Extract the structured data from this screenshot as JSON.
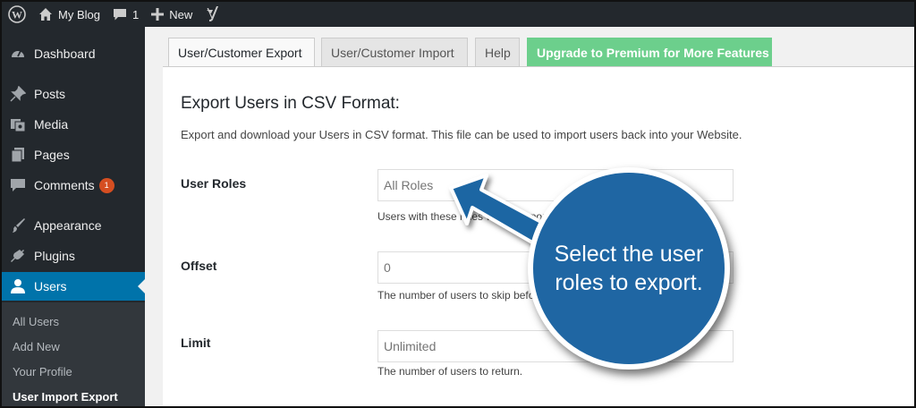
{
  "adminbar": {
    "site_name": "My Blog",
    "comments_count": "1",
    "new_label": "New"
  },
  "sidebar": {
    "items": [
      {
        "label": "Dashboard",
        "icon": "dashboard-icon"
      },
      {
        "label": "Posts",
        "icon": "pin-icon"
      },
      {
        "label": "Media",
        "icon": "media-icon"
      },
      {
        "label": "Pages",
        "icon": "pages-icon"
      },
      {
        "label": "Comments",
        "icon": "comment-icon",
        "badge": "1"
      },
      {
        "label": "Appearance",
        "icon": "brush-icon"
      },
      {
        "label": "Plugins",
        "icon": "plug-icon"
      },
      {
        "label": "Users",
        "icon": "user-icon",
        "active": true
      }
    ],
    "submenu": [
      "All Users",
      "Add New",
      "Your Profile",
      "User Import Export"
    ],
    "current_submenu": "User Import Export"
  },
  "tabs": [
    "User/Customer Export",
    "User/Customer Import",
    "Help",
    "Upgrade to Premium for More Features"
  ],
  "main": {
    "title": "Export Users in CSV Format:",
    "description": "Export and download your Users in CSV format. This file can be used to import users back into your Website.",
    "fields": [
      {
        "label": "User Roles",
        "placeholder": "All Roles",
        "help": "Users with these roles will be exported."
      },
      {
        "label": "Offset",
        "placeholder": "0",
        "help": "The number of users to skip before exporting."
      },
      {
        "label": "Limit",
        "placeholder": "Unlimited",
        "help": "The number of users to return."
      }
    ]
  },
  "callout": {
    "text": "Select the user roles to export."
  },
  "colors": {
    "adminbar": "#23282d",
    "active_menu": "#0073aa",
    "premium_tab": "#6ccf8c",
    "callout": "#1f66a3",
    "badge": "#d54e21"
  }
}
